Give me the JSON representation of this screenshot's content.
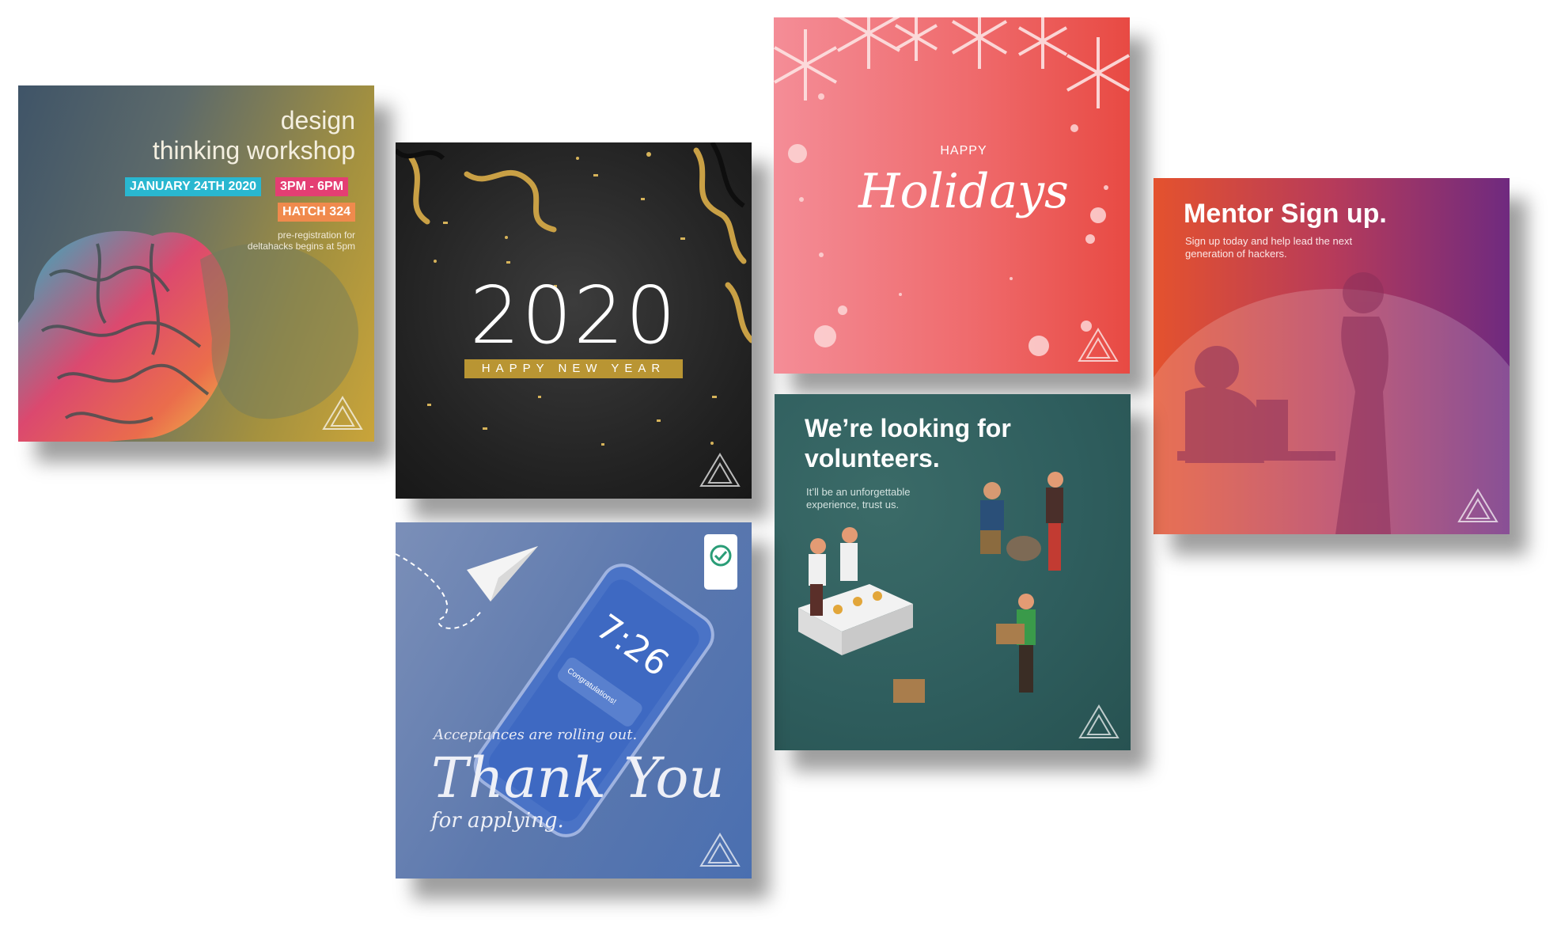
{
  "cards": {
    "design": {
      "title_line1": "design",
      "title_line2": "thinking workshop",
      "date": "JANUARY 24TH 2020",
      "time": "3PM - 6PM",
      "location": "HATCH 324",
      "note": "pre-registration for deltahacks begins at 5pm"
    },
    "newyear": {
      "year": "2020",
      "banner": "HAPPY NEW YEAR"
    },
    "holidays": {
      "happy": "HAPPY",
      "script": "Holidays"
    },
    "mentor": {
      "title": "Mentor Sign up.",
      "subtitle": "Sign up today and help lead the next generation of hackers."
    },
    "volunteers": {
      "title": "We’re looking for volunteers.",
      "subtitle": "It’ll be an unforgettable experience, trust us."
    },
    "thanks": {
      "line1": "Acceptances are rolling out.",
      "big": "Thank You",
      "line2": "for applying.",
      "phone_time": "7:26",
      "notification_title": "Congratulations!"
    }
  },
  "colors": {
    "pill_date": "#29b7d0",
    "pill_time": "#e43e73",
    "pill_location": "#f08a4d",
    "gold": "#b99533"
  }
}
